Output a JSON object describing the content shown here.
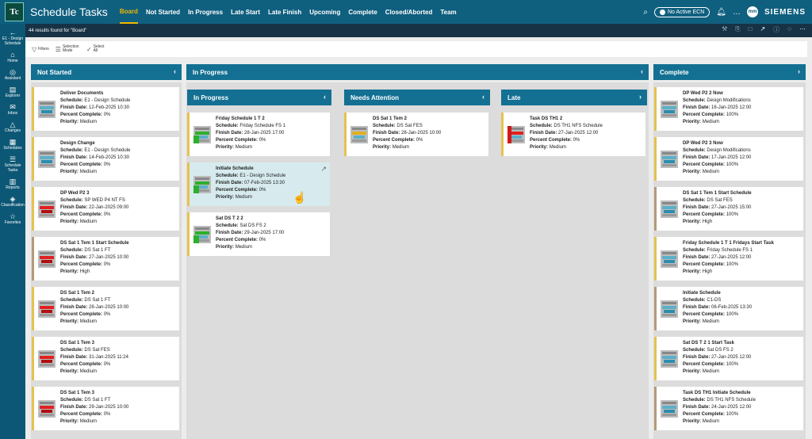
{
  "app": {
    "logo": "Tc",
    "title": "Schedule Tasks"
  },
  "nav": [
    {
      "label": "Board",
      "active": true
    },
    {
      "label": "Not Started"
    },
    {
      "label": "In Progress"
    },
    {
      "label": "Late Start"
    },
    {
      "label": "Late Finish"
    },
    {
      "label": "Upcoming"
    },
    {
      "label": "Complete"
    },
    {
      "label": "Closed/Aborted"
    },
    {
      "label": "Team"
    }
  ],
  "topright": {
    "ecn": "No Active ECN",
    "avatar": "mm",
    "brand": "SIEMENS"
  },
  "sidebar": [
    {
      "icon": "e1-design-schedule-icon",
      "glyph": "←",
      "label": "E1 - Design Schedule"
    },
    {
      "icon": "home-icon",
      "glyph": "⌂",
      "label": "Home"
    },
    {
      "icon": "assistant-icon",
      "glyph": "◎",
      "label": "Assistant"
    },
    {
      "icon": "explorer-icon",
      "glyph": "▤",
      "label": "Explorer"
    },
    {
      "icon": "inbox-icon",
      "glyph": "✉",
      "label": "Inbox"
    },
    {
      "icon": "changes-icon",
      "glyph": "△",
      "label": "Changes"
    },
    {
      "icon": "schedules-icon",
      "glyph": "▦",
      "label": "Schedules"
    },
    {
      "icon": "schedule-tasks-icon",
      "glyph": "☰",
      "label": "Schedule Tasks"
    },
    {
      "icon": "reports-icon",
      "glyph": "▥",
      "label": "Reports"
    },
    {
      "icon": "classification-icon",
      "glyph": "◈",
      "label": "Classification"
    },
    {
      "icon": "favorites-icon",
      "glyph": "☆",
      "label": "Favorites"
    }
  ],
  "subbar": {
    "results": "44 results found for \"Board\""
  },
  "cmdbar": [
    {
      "label": "Filters",
      "icon": "filter-icon",
      "glyph": "⩒"
    },
    {
      "label": "Selection Mode",
      "icon": "selection-mode-icon",
      "glyph": "☰"
    },
    {
      "label": "Select All",
      "icon": "select-all-icon",
      "glyph": "✓"
    }
  ],
  "labels": {
    "schedule": "Schedule:",
    "finish": "Finish Date:",
    "percent": "Percent Complete:",
    "priority": "Priority:"
  },
  "columns": {
    "not_started": "Not Started",
    "in_progress": "In Progress",
    "in_progress_sub": "In Progress",
    "needs_attention": "Needs Attention",
    "late": "Late",
    "complete": "Complete"
  },
  "cards": {
    "not_started": [
      {
        "title": "Deliver Documents",
        "schedule": "E1 - Design Schedule",
        "finish": "12-Feb-2025 10:30",
        "percent": "0%",
        "priority": "Medium",
        "thumb": "teal"
      },
      {
        "title": "Design Change",
        "schedule": "E1 - Design Schedule",
        "finish": "14-Feb-2025 10:30",
        "percent": "0%",
        "priority": "Medium",
        "thumb": "teal"
      },
      {
        "title": "DP Wed P2 3",
        "schedule": "SP WED P4 NT FS",
        "finish": "22-Jan-2025 09:00",
        "percent": "0%",
        "priority": "Medium",
        "thumb": "red"
      },
      {
        "title": "DS Sat 1 Tem 1 Start Schedule",
        "schedule": "DS Sat 1 FT",
        "finish": "27-Jan-2025 10:00",
        "percent": "0%",
        "priority": "High",
        "thumb": "red"
      },
      {
        "title": "DS Sat 1 Tem 2",
        "schedule": "DS Sat 1 FT",
        "finish": "28-Jan-2025 10:00",
        "percent": "0%",
        "priority": "Medium",
        "thumb": "red"
      },
      {
        "title": "DS Sat 1 Tem 3",
        "schedule": "DS Sat FES",
        "finish": "31-Jan-2025 11:24",
        "percent": "0%",
        "priority": "Medium",
        "thumb": "red"
      },
      {
        "title": "DS Sat 1 Tem 3",
        "schedule": "DS Sat 1 FT",
        "finish": "29-Jan-2025 10:00",
        "percent": "0%",
        "priority": "Medium",
        "thumb": "red"
      }
    ],
    "in_progress": [
      {
        "title": "Friday Schedule 1 T 2",
        "schedule": "Friday Schedule FS 1",
        "finish": "28-Jan-2025 17:00",
        "percent": "0%",
        "priority": "Medium",
        "thumb": "green"
      },
      {
        "title": "Initiate Schedule",
        "schedule": "E1 - Design Schedule",
        "finish": "07-Feb-2025 13:30",
        "percent": "0%",
        "priority": "Medium",
        "thumb": "green"
      },
      {
        "title": "Sat DS T 2 2",
        "schedule": "Sat DS FS 2",
        "finish": "29-Jan-2025 17:00",
        "percent": "0%",
        "priority": "Medium",
        "thumb": "green"
      }
    ],
    "needs_attention": [
      {
        "title": "DS Sat 1 Tem 2",
        "schedule": "DS Sat FES",
        "finish": "28-Jan-2025 10:00",
        "percent": "0%",
        "priority": "Medium",
        "thumb": "yellow"
      }
    ],
    "late": [
      {
        "title": "Task DS TH1 2",
        "schedule": "DS TH1 NFS Schedule",
        "finish": "27-Jan-2025 12:00",
        "percent": "0%",
        "priority": "Medium",
        "thumb": "redside"
      }
    ],
    "complete": [
      {
        "title": "DP Wed P2 2 Now",
        "schedule": "Design Modifications",
        "finish": "16-Jan-2025 12:00",
        "percent": "100%",
        "priority": "Medium",
        "thumb": "teal"
      },
      {
        "title": "DP Wed P2 3 Now",
        "schedule": "Design Modifications",
        "finish": "17-Jan-2025 12:00",
        "percent": "100%",
        "priority": "Medium",
        "thumb": "teal"
      },
      {
        "title": "DS Sat 1 Tem 1 Start Schedule",
        "schedule": "DS Sat FES",
        "finish": "27-Jan-2025 15:00",
        "percent": "100%",
        "priority": "High",
        "thumb": "teal"
      },
      {
        "title": "Friday Schedule 1 T 1 Fridays Start Task",
        "schedule": "Friday Schedule FS 1",
        "finish": "27-Jan-2025 12:00",
        "percent": "100%",
        "priority": "High",
        "thumb": "teal"
      },
      {
        "title": "Initiate Schedule",
        "schedule": "C1-DS",
        "finish": "06-Feb-2025 13:30",
        "percent": "100%",
        "priority": "Medium",
        "thumb": "teal"
      },
      {
        "title": "Sat DS T 2 1 Start Task",
        "schedule": "Sat DS FS 2",
        "finish": "27-Jan-2025 12:00",
        "percent": "100%",
        "priority": "Medium",
        "thumb": "teal"
      },
      {
        "title": "Task DS TH1 Initiate Schedule",
        "schedule": "DS TH1 NFS Schedule",
        "finish": "24-Jan-2025 12:00",
        "percent": "100%",
        "priority": "Medium",
        "thumb": "teal"
      }
    ]
  },
  "colors": {
    "accent": "#f0b800",
    "header": "#0f5f7f",
    "column_header": "#137092"
  }
}
